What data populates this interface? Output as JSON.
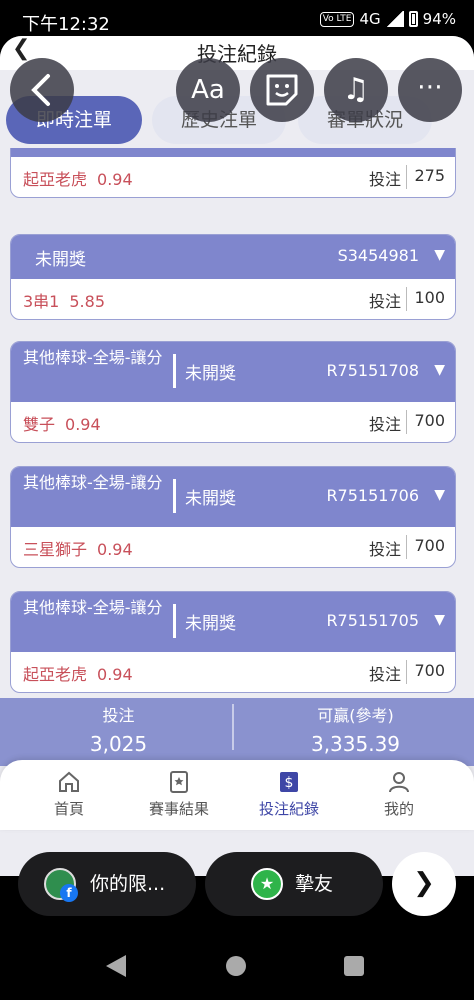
{
  "status_bar": {
    "time": "下午12:32",
    "network": "4G",
    "volte": "Vo LTE",
    "battery": "94%"
  },
  "header": {
    "title": "投注紀錄"
  },
  "tabs": [
    {
      "label": "即時注單",
      "active": true
    },
    {
      "label": "歷史注單",
      "active": false
    },
    {
      "label": "審單狀況",
      "active": false
    }
  ],
  "cards": [
    {
      "pick": "起亞老虎",
      "odds": "0.94",
      "bet_label": "投注",
      "amount": "275"
    },
    {
      "status": "未開獎",
      "code": "S3454981",
      "pick": "3串1",
      "odds": "5.85",
      "bet_label": "投注",
      "amount": "100"
    },
    {
      "sport": "其他棒球-全場-讓分",
      "status": "未開獎",
      "code": "R75151708",
      "pick": "雙子",
      "odds": "0.94",
      "bet_label": "投注",
      "amount": "700"
    },
    {
      "sport": "其他棒球-全場-讓分",
      "status": "未開獎",
      "code": "R75151706",
      "pick": "三星獅子",
      "odds": "0.94",
      "bet_label": "投注",
      "amount": "700"
    },
    {
      "sport": "其他棒球-全場-讓分",
      "status": "未開獎",
      "code": "R75151705",
      "pick": "起亞老虎",
      "odds": "0.94",
      "bet_label": "投注",
      "amount": "700"
    }
  ],
  "summary": {
    "bet_label": "投注",
    "bet_value": "3,025",
    "win_label": "可贏(參考)",
    "win_value": "3,335.39"
  },
  "bottom_nav": [
    {
      "label": "首頁",
      "icon": "home-icon"
    },
    {
      "label": "賽事結果",
      "icon": "results-icon"
    },
    {
      "label": "投注紀錄",
      "icon": "bet-record-icon",
      "active": true
    },
    {
      "label": "我的",
      "icon": "user-icon"
    }
  ],
  "overlay": {
    "aa_label": "Aa",
    "chat1_label": "你的限...",
    "chat2_label": "摯友"
  },
  "colors": {
    "accent": "#5a66b8",
    "card_header": "#7f86cd",
    "pick_text": "#c8505a"
  }
}
